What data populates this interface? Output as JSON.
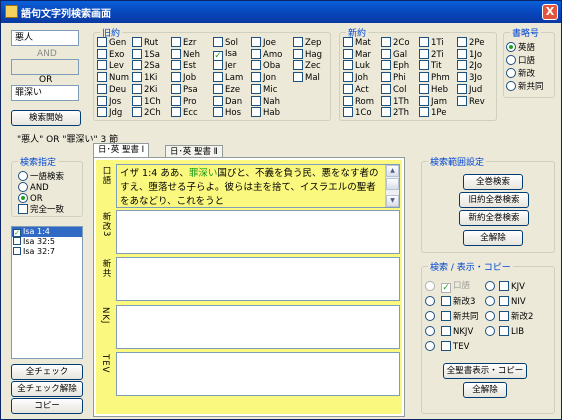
{
  "window": {
    "title": "語句文字列検索画面",
    "close": "X"
  },
  "search": {
    "input1": "悪人",
    "and_label": "AND",
    "input2": "",
    "or_label": "OR",
    "input3": "罪深い",
    "start_button": "検索開始",
    "result_summary": "\"悪人\" OR \"罪深い\"  3 節"
  },
  "mode": {
    "title": "検索指定",
    "options": [
      {
        "label": "一語検索",
        "checked": false
      },
      {
        "label": "AND",
        "checked": false
      },
      {
        "label": "OR",
        "checked": true
      }
    ],
    "exact": {
      "label": "完全一致",
      "checked": false
    }
  },
  "results": {
    "items": [
      {
        "label": "Isa  1:4",
        "checked": true,
        "selected": true
      },
      {
        "label": "Isa  32:5",
        "checked": false,
        "selected": false
      },
      {
        "label": "Isa  32:7",
        "checked": false,
        "selected": false
      }
    ]
  },
  "bottom_buttons": {
    "check_all": "全チェック",
    "uncheck_all": "全チェック解除",
    "copy": "コピー"
  },
  "ot": {
    "title": "旧約",
    "books": [
      {
        "label": "Gen",
        "checked": false
      },
      {
        "label": "Exo",
        "checked": false
      },
      {
        "label": "Lev",
        "checked": false
      },
      {
        "label": "Num",
        "checked": false
      },
      {
        "label": "Deu",
        "checked": false
      },
      {
        "label": "Jos",
        "checked": false
      },
      {
        "label": "Jdg",
        "checked": false
      },
      {
        "label": "Rut",
        "checked": false
      },
      {
        "label": "1Sa",
        "checked": false
      },
      {
        "label": "2Sa",
        "checked": false
      },
      {
        "label": "1Ki",
        "checked": false
      },
      {
        "label": "2Ki",
        "checked": false
      },
      {
        "label": "1Ch",
        "checked": false
      },
      {
        "label": "2Ch",
        "checked": false
      },
      {
        "label": "Ezr",
        "checked": false
      },
      {
        "label": "Neh",
        "checked": false
      },
      {
        "label": "Est",
        "checked": false
      },
      {
        "label": "Job",
        "checked": false
      },
      {
        "label": "Psa",
        "checked": false
      },
      {
        "label": "Pro",
        "checked": false
      },
      {
        "label": "Ecc",
        "checked": false
      },
      {
        "label": "Sol",
        "checked": false
      },
      {
        "label": "Isa",
        "checked": true
      },
      {
        "label": "Jer",
        "checked": false
      },
      {
        "label": "Lam",
        "checked": false
      },
      {
        "label": "Eze",
        "checked": false
      },
      {
        "label": "Dan",
        "checked": false
      },
      {
        "label": "Hos",
        "checked": false
      },
      {
        "label": "Joe",
        "checked": false
      },
      {
        "label": "Amo",
        "checked": false
      },
      {
        "label": "Oba",
        "checked": false
      },
      {
        "label": "Jon",
        "checked": false
      },
      {
        "label": "Mic",
        "checked": false
      },
      {
        "label": "Nah",
        "checked": false
      },
      {
        "label": "Hab",
        "checked": false
      },
      {
        "label": "Zep",
        "checked": false
      },
      {
        "label": "Hag",
        "checked": false
      },
      {
        "label": "Zec",
        "checked": false
      },
      {
        "label": "Mal",
        "checked": false
      }
    ]
  },
  "nt": {
    "title": "新約",
    "books": [
      {
        "label": "Mat",
        "checked": false
      },
      {
        "label": "Mar",
        "checked": false
      },
      {
        "label": "Luk",
        "checked": false
      },
      {
        "label": "Joh",
        "checked": false
      },
      {
        "label": "Act",
        "checked": false
      },
      {
        "label": "Rom",
        "checked": false
      },
      {
        "label": "1Co",
        "checked": false
      },
      {
        "label": "2Co",
        "checked": false
      },
      {
        "label": "Gal",
        "checked": false
      },
      {
        "label": "Eph",
        "checked": false
      },
      {
        "label": "Phi",
        "checked": false
      },
      {
        "label": "Col",
        "checked": false
      },
      {
        "label": "1Th",
        "checked": false
      },
      {
        "label": "2Th",
        "checked": false
      },
      {
        "label": "1Ti",
        "checked": false
      },
      {
        "label": "2Ti",
        "checked": false
      },
      {
        "label": "Tit",
        "checked": false
      },
      {
        "label": "Phm",
        "checked": false
      },
      {
        "label": "Heb",
        "checked": false
      },
      {
        "label": "Jam",
        "checked": false
      },
      {
        "label": "1Pe",
        "checked": false
      },
      {
        "label": "2Pe",
        "checked": false
      },
      {
        "label": "1Jo",
        "checked": false
      },
      {
        "label": "2Jo",
        "checked": false
      },
      {
        "label": "3Jo",
        "checked": false
      },
      {
        "label": "Jud",
        "checked": false
      },
      {
        "label": "Rev",
        "checked": false
      }
    ]
  },
  "abbr": {
    "title": "書略号",
    "options": [
      {
        "label": "英語",
        "checked": true
      },
      {
        "label": "口語",
        "checked": false
      },
      {
        "label": "新改",
        "checked": false
      },
      {
        "label": "新共同",
        "checked": false
      }
    ]
  },
  "tabs": [
    {
      "label": "日･英 聖書 Ⅰ",
      "active": true
    },
    {
      "label": "日･英 聖書 Ⅱ",
      "active": false
    }
  ],
  "passages": [
    {
      "name": "口語",
      "verse": "イザ  1:4 ああ、",
      "highlight": "罪深い",
      "rest": "国びと、不義を負う民、悪をなす者のすえ、堕落せる子らよ。彼らは主を捨て、イスラエルの聖者をあなどり、これをうと"
    },
    {
      "name": "新改3"
    },
    {
      "name": "新共"
    },
    {
      "name": "NKJ"
    },
    {
      "name": "TEV"
    }
  ],
  "range": {
    "title": "検索範囲設定",
    "buttons": [
      "全巻検索",
      "旧約全巻検索",
      "新約全巻検索",
      "全解除"
    ]
  },
  "display": {
    "title": "検索 / 表示・コピー",
    "left": [
      {
        "label": "口語",
        "checked": true,
        "disabled": true
      },
      {
        "label": "新改3",
        "checked": false
      },
      {
        "label": "新共同",
        "checked": false
      },
      {
        "label": "NKJV",
        "checked": false
      },
      {
        "label": "TEV",
        "checked": false
      }
    ],
    "right": [
      {
        "label": "KJV",
        "checked": false
      },
      {
        "label": "NIV",
        "checked": false
      },
      {
        "label": "新改2",
        "checked": false
      },
      {
        "label": "LIB",
        "checked": false
      }
    ],
    "show_copy": "全聖書表示・コピー",
    "clear": "全解除"
  }
}
